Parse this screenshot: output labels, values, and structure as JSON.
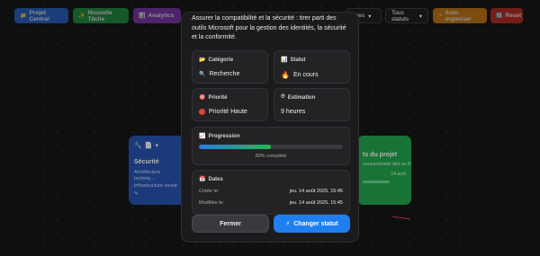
{
  "toolbar": {
    "buttons": [
      {
        "icon": "folder-icon",
        "glyph": "📁",
        "label": "Projet Central"
      },
      {
        "icon": "sparkle-icon",
        "glyph": "✨",
        "label": "Nouvelle Tâche"
      },
      {
        "icon": "chart-icon",
        "glyph": "📊",
        "label": "Analytics"
      },
      {
        "icon": "robot-icon",
        "glyph": "⚡",
        "label": "Auto-organiser"
      },
      {
        "icon": "reset-icon",
        "glyph": "🔄",
        "label": "Reset"
      }
    ],
    "filter_category": "ories",
    "filter_status": "Tous statuts"
  },
  "bg_cards": {
    "blue": {
      "title": "Sécurité",
      "desc": "Architecture techniq… infrastructure locale"
    },
    "green": {
      "title": "ts du projet",
      "desc": "souveraineté des  ar l'envoi de …",
      "date": "14 août"
    }
  },
  "modal": {
    "description": "Assurer la compatibilité et la sécurité : tirer parti des outils Microsoft pour la gestion des identités, la sécurité et la conformité.",
    "category": {
      "label": "Catégorie",
      "value": "Recherche"
    },
    "status": {
      "label": "Statut",
      "value": "En cours"
    },
    "priority": {
      "label": "Priorité",
      "value": "Priorité Haute"
    },
    "estimate": {
      "label": "Estimation",
      "value": "9 heures"
    },
    "progress": {
      "label": "Progression",
      "percent": 50,
      "text": "50% complété"
    },
    "dates": {
      "label": "Dates",
      "created_key": "Créée le:",
      "created_value": "jeu. 14 août 2025, 15:45",
      "modified_key": "Modifiée le:",
      "modified_value": "jeu. 14 août 2025, 15:45"
    },
    "close_label": "Fermer",
    "change_label": "Changer statut"
  },
  "colors": {
    "accent": "#1f7ff0",
    "priority_high": "#e0413b",
    "progress_start": "#2a7de0",
    "progress_end": "#23b84c"
  }
}
